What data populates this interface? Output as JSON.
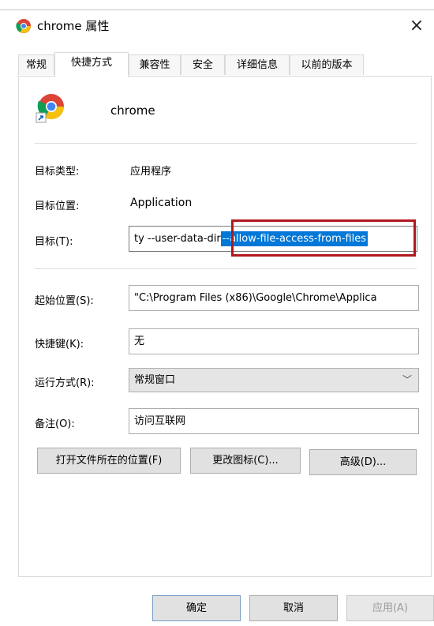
{
  "window": {
    "title": "chrome 属性",
    "close_glyph": "×"
  },
  "tabs": [
    {
      "label": "常规"
    },
    {
      "label": "快捷方式"
    },
    {
      "label": "兼容性"
    },
    {
      "label": "安全"
    },
    {
      "label": "详细信息"
    },
    {
      "label": "以前的版本"
    }
  ],
  "active_tab": "快捷方式",
  "app": {
    "name": "chrome",
    "icon": "chrome-shortcut-icon"
  },
  "fields": {
    "target_type_label": "目标类型:",
    "target_type_value": "应用程序",
    "target_location_label": "目标位置:",
    "target_location_value": "Application",
    "target_label": "目标(T):",
    "target_value_prefix": "ty --user-data-dir",
    "target_value_selected": "--allow-file-access-from-files",
    "start_in_label": "起始位置(S):",
    "start_in_value": "\"C:\\Program Files (x86)\\Google\\Chrome\\Applica",
    "shortcut_key_label": "快捷键(K):",
    "shortcut_key_value": "无",
    "run_label": "运行方式(R):",
    "run_value": "常规窗口",
    "comment_label": "备注(O):",
    "comment_value": "访问互联网"
  },
  "actions": {
    "open_location": "打开文件所在的位置(F)",
    "change_icon": "更改图标(C)...",
    "advanced": "高级(D)..."
  },
  "footer": {
    "ok": "确定",
    "cancel": "取消",
    "apply": "应用(A)"
  },
  "colors": {
    "selection": "#0078d7",
    "highlight_box": "#b0191e"
  }
}
